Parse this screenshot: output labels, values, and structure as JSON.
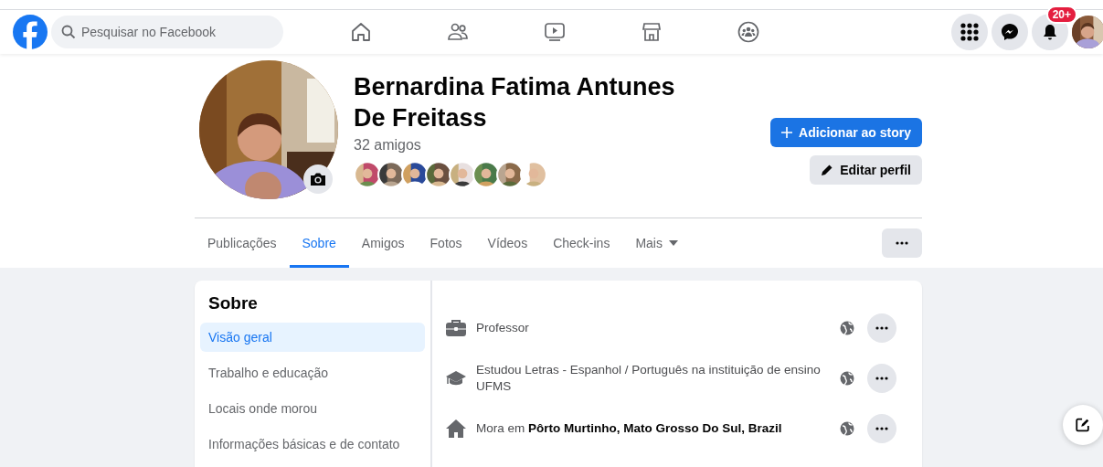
{
  "header": {
    "search": {
      "placeholder": "Pesquisar no Facebook"
    },
    "nav": [
      {
        "kind": "home"
      },
      {
        "kind": "friends"
      },
      {
        "kind": "watch"
      },
      {
        "kind": "marketplace"
      },
      {
        "kind": "groups"
      }
    ],
    "actions": [
      {
        "kind": "menu"
      },
      {
        "kind": "messenger"
      },
      {
        "kind": "notifications",
        "badge": "20+"
      },
      {
        "kind": "account"
      }
    ]
  },
  "profile": {
    "name": "Bernardina Fatima Antunes De Freitass",
    "friends_count": "32 amigos",
    "buttons": [
      {
        "kind": "primary",
        "label": "Adicionar ao story"
      },
      {
        "kind": "secondary",
        "label": "Editar perfil"
      }
    ]
  },
  "tabs": [
    {
      "label": "Publicações",
      "selected": false
    },
    {
      "label": "Sobre",
      "selected": true
    },
    {
      "label": "Amigos",
      "selected": false
    },
    {
      "label": "Fotos",
      "selected": false
    },
    {
      "label": "Vídeos",
      "selected": false
    },
    {
      "label": "Check-ins",
      "selected": false
    },
    {
      "label": "Mais",
      "selected": false,
      "kind": "dropdown"
    }
  ],
  "about": {
    "title": "Sobre",
    "sidebar": [
      {
        "label": "Visão geral",
        "selected": true
      },
      {
        "label": "Trabalho e educação",
        "selected": false
      },
      {
        "label": "Locais onde morou",
        "selected": false
      },
      {
        "label": "Informações básicas e de contato",
        "selected": false
      }
    ],
    "rows": [
      {
        "kind": "work",
        "text": "Professor"
      },
      {
        "kind": "education",
        "text": "Estudou Letras - Espanhol / Português na instituição de ensino UFMS"
      },
      {
        "kind": "home",
        "text": "Mora em **Pôrto Murtinho, Mato Grosso Do Sul, Brazil**"
      }
    ]
  }
}
